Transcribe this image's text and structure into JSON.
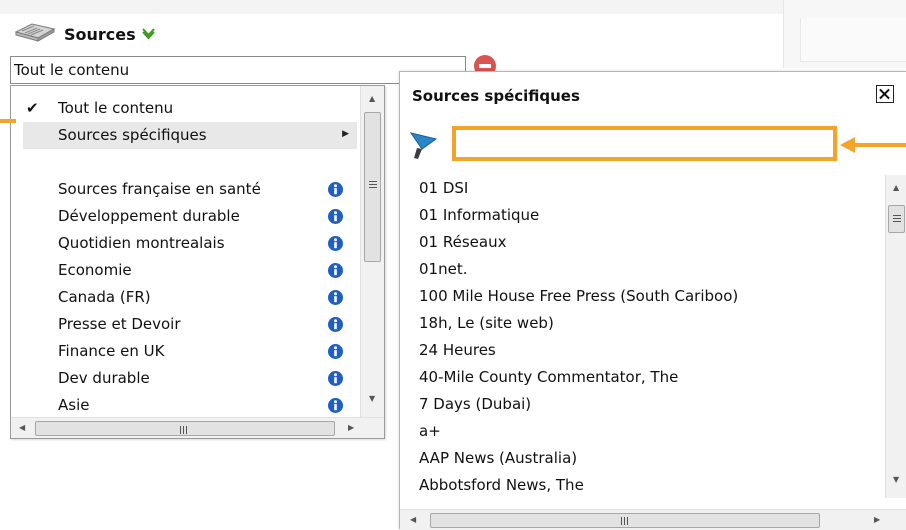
{
  "sources_header": {
    "title": "Sources",
    "icon": "newspapers-icon",
    "chevron_icon": "chevron-down-icon"
  },
  "selector": {
    "value": "Tout le contenu"
  },
  "dropdown": {
    "selected_label": "Tout le contenu",
    "submenu_label": "Sources spécifiques",
    "items": [
      {
        "label": "Sources française en santé"
      },
      {
        "label": "Développement durable"
      },
      {
        "label": "Quotidien montrealais"
      },
      {
        "label": "Economie"
      },
      {
        "label": "Canada (FR)"
      },
      {
        "label": "Presse et Devoir"
      },
      {
        "label": "Finance en UK"
      },
      {
        "label": "Dev durable"
      },
      {
        "label": "Asie"
      }
    ]
  },
  "panel": {
    "title": "Sources spécifiques",
    "filter_value": "",
    "sources": [
      "01 DSI",
      "01 Informatique",
      "01 Réseaux",
      "01net.",
      "100 Mile House Free Press (South Cariboo)",
      "18h, Le (site web)",
      "24 Heures",
      "40-Mile County Commentator, The",
      "7 Days (Dubai)",
      "a+",
      "AAP News (Australia)",
      "Abbotsford News, The"
    ]
  },
  "colors": {
    "callout": "#f5a42a",
    "info": "#1f5fc4",
    "chevron": "#3a9a1e",
    "remove": "#d9534f"
  }
}
